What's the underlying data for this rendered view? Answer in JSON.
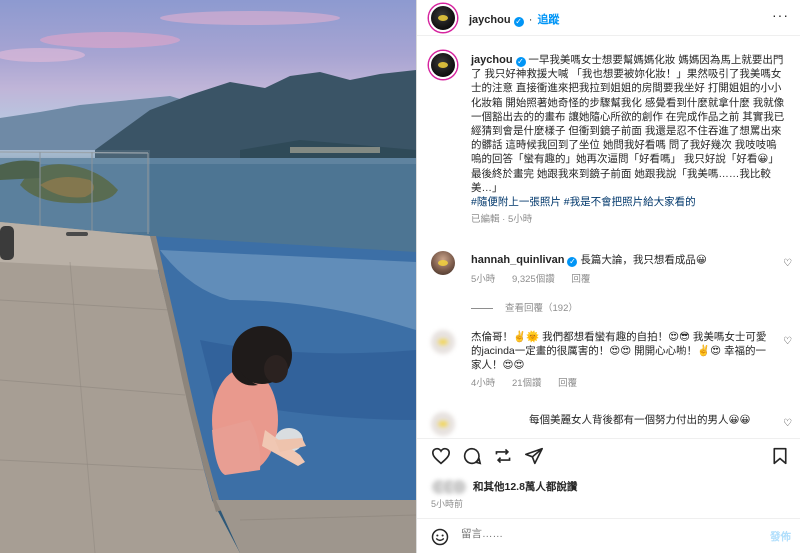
{
  "post": {
    "username": "jaychou",
    "follow_label": "追蹤",
    "caption_text": "一早我美嗎女士想要幫媽媽化妝 媽媽因為馬上就要出門了 我只好神救援大喊 「我也想要被妳化妝！」果然吸引了我美嗎女士的注意 直接衝進來把我拉到姐姐的房間要我坐好 打開姐姐的小小化妝箱 開始照著她奇怪的步驟幫我化 感覺看到什麼就拿什麼 我就像一個豁出去的的畫布 讓她隨心所欲的創作 在完成作品之前 其實我已經猜到會是什麼樣子 但衝到鏡子前面 我還是忍不住吞進了想罵出來的髒話 這時候我回到了坐位 她問我好看嗎 問了我好幾次 我吱吱嗚嗚的回答「蠻有趣的」她再次逼問「好看嗎」 我只好說「好看😀」最後終於畫完 她跟我來到鏡子前面 她跟我說「我美嗎……我比較美…」",
    "hashtags": "#隨便附上一張照片 #我是不會把照片給大家看的",
    "caption_meta": "已編輯 · 5小時"
  },
  "comments": [
    {
      "username": "hannah_quinlivan",
      "text": "長篇大論，我只想看成品😀",
      "time": "5小時",
      "likes": "9,325個讚",
      "reply_label": "回覆",
      "view_replies": "查看回覆（192）"
    },
    {
      "username": "",
      "text": "杰倫哥！✌️🌞 我們都想看蠻有趣的自拍！😍😎 我美嗎女士可愛的jacinda一定畫的很厲害的！😍😍 開開心心喲！✌️😍 幸福的一家人！😍😍",
      "time": "4小時",
      "likes": "21個讚",
      "reply_label": "回覆"
    },
    {
      "username": "",
      "text": "每個美麗女人背後都有一個努力付出的男人😀😀",
      "time": "",
      "likes": "",
      "reply_label": ""
    }
  ],
  "likes_summary": "和其他12.8萬人都說讚",
  "post_time": "5小時前",
  "add_comment": {
    "placeholder": "留言……",
    "post_label": "發佈"
  },
  "icons": [
    "heart-icon",
    "comment-icon",
    "share-icon",
    "save-icon",
    "emoji-icon",
    "more-icon",
    "verified-icon"
  ],
  "colors": {
    "link": "#0095f6",
    "hashtag": "#00376b",
    "muted": "#8e8e8e"
  }
}
